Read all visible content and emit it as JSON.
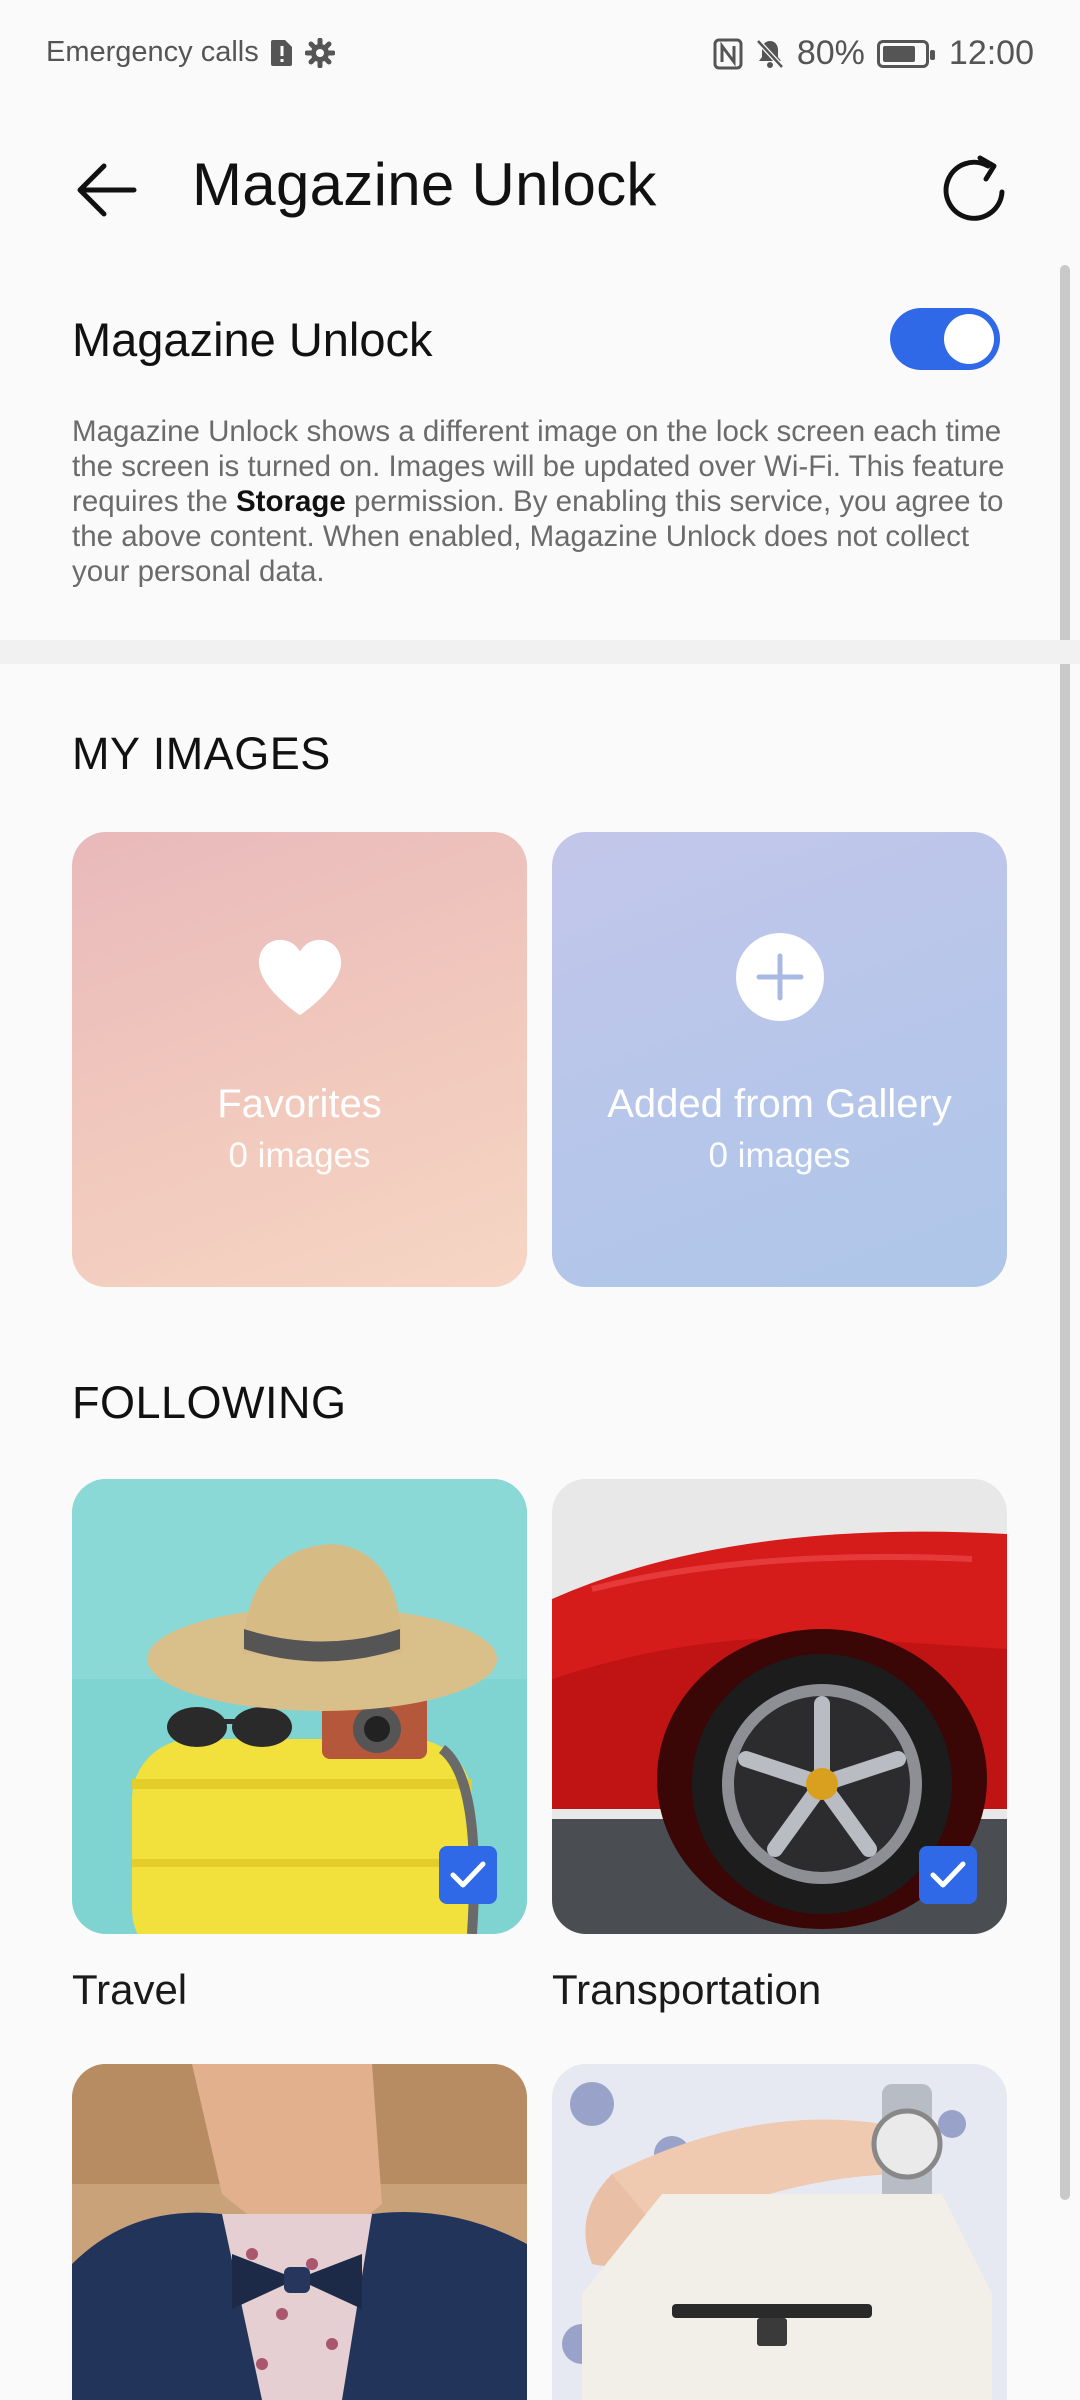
{
  "status_bar": {
    "left_text": "Emergency calls",
    "battery": "80%",
    "battery_level": 0.8,
    "time": "12:00",
    "icons": [
      "sim-alert-icon",
      "settings-gear-icon",
      "nfc-icon",
      "bell-muted-icon",
      "battery-icon"
    ]
  },
  "app_bar": {
    "title": "Magazine Unlock",
    "back_icon": "arrow-left-icon",
    "refresh_icon": "refresh-icon"
  },
  "toggle": {
    "label": "Magazine Unlock",
    "state": "on",
    "accent_color": "#2f69e8"
  },
  "description": {
    "part1": "Magazine Unlock shows a different image on the lock screen each time the screen is turned on. Images will be updated over Wi-Fi. This feature requires the ",
    "bold": "Storage",
    "part2": " permission. By enabling this service, you agree to the above content. When enabled, Magazine Unlock does not collect your personal data."
  },
  "my_images": {
    "section_title": "MY IMAGES",
    "cards": [
      {
        "title": "Favorites",
        "count": "0 images",
        "icon": "heart-icon"
      },
      {
        "title": "Added from Gallery",
        "count": "0 images",
        "icon": "plus-icon"
      }
    ]
  },
  "following": {
    "section_title": "FOLLOWING",
    "items": [
      {
        "label": "Travel",
        "checked": true
      },
      {
        "label": "Transportation",
        "checked": true
      },
      {
        "label": "",
        "checked": false
      },
      {
        "label": "",
        "checked": false
      }
    ]
  }
}
